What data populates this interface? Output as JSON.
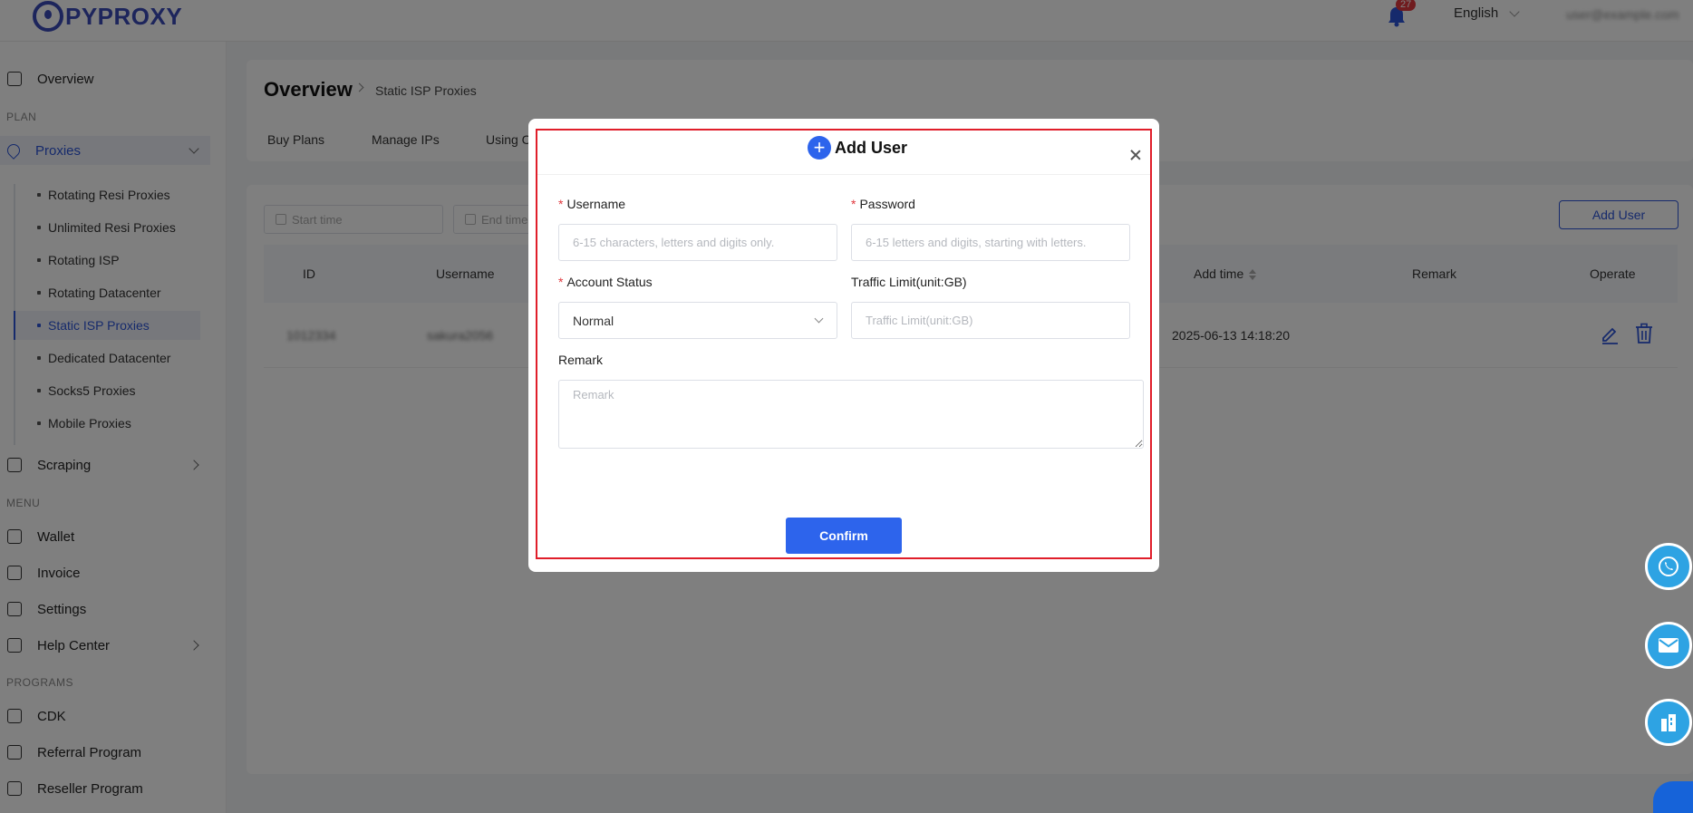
{
  "header": {
    "logo_text": "PYPROXY",
    "notification_count": "27",
    "language": "English",
    "account": "user@example.com"
  },
  "sidebar": {
    "overview": "Overview",
    "section_plan": "PLAN",
    "proxies": "Proxies",
    "proxy_items": [
      "Rotating Resi Proxies",
      "Unlimited Resi Proxies",
      "Rotating ISP",
      "Rotating Datacenter",
      "Static ISP Proxies",
      "Dedicated Datacenter",
      "Socks5 Proxies",
      "Mobile Proxies"
    ],
    "scraping": "Scraping",
    "section_menu": "MENU",
    "wallet": "Wallet",
    "invoice": "Invoice",
    "settings": "Settings",
    "help_center": "Help Center",
    "section_programs": "PROGRAMS",
    "cdk": "CDK",
    "referral": "Referral Program",
    "reseller": "Reseller Program"
  },
  "page": {
    "title": "Overview",
    "breadcrumb": "Static ISP Proxies",
    "tabs": [
      "Buy Plans",
      "Manage IPs",
      "Using C"
    ]
  },
  "filters": {
    "start_placeholder": "Start time",
    "end_placeholder": "End time",
    "add_user": "Add User"
  },
  "table": {
    "headers": {
      "id": "ID",
      "username": "Username",
      "add_time": "Add time",
      "remark": "Remark",
      "operate": "Operate"
    },
    "rows": [
      {
        "id": "1012334",
        "username": "sakura2056",
        "add_time": "2025-06-13 14:18:20"
      }
    ]
  },
  "modal": {
    "title": "Add User",
    "username_label": "Username",
    "username_placeholder": "6-15 characters, letters and digits only.",
    "password_label": "Password",
    "password_placeholder": "6-15 letters and digits, starting with letters.",
    "status_label": "Account Status",
    "status_value": "Normal",
    "traffic_label": "Traffic Limit(unit:GB)",
    "traffic_placeholder": "Traffic Limit(unit:GB)",
    "remark_label": "Remark",
    "remark_placeholder": "Remark",
    "confirm": "Confirm",
    "required_mark": "*"
  },
  "colors": {
    "primary": "#2d64ec",
    "highlight_border": "#e01e2a",
    "float_button": "#2ea3e3"
  }
}
